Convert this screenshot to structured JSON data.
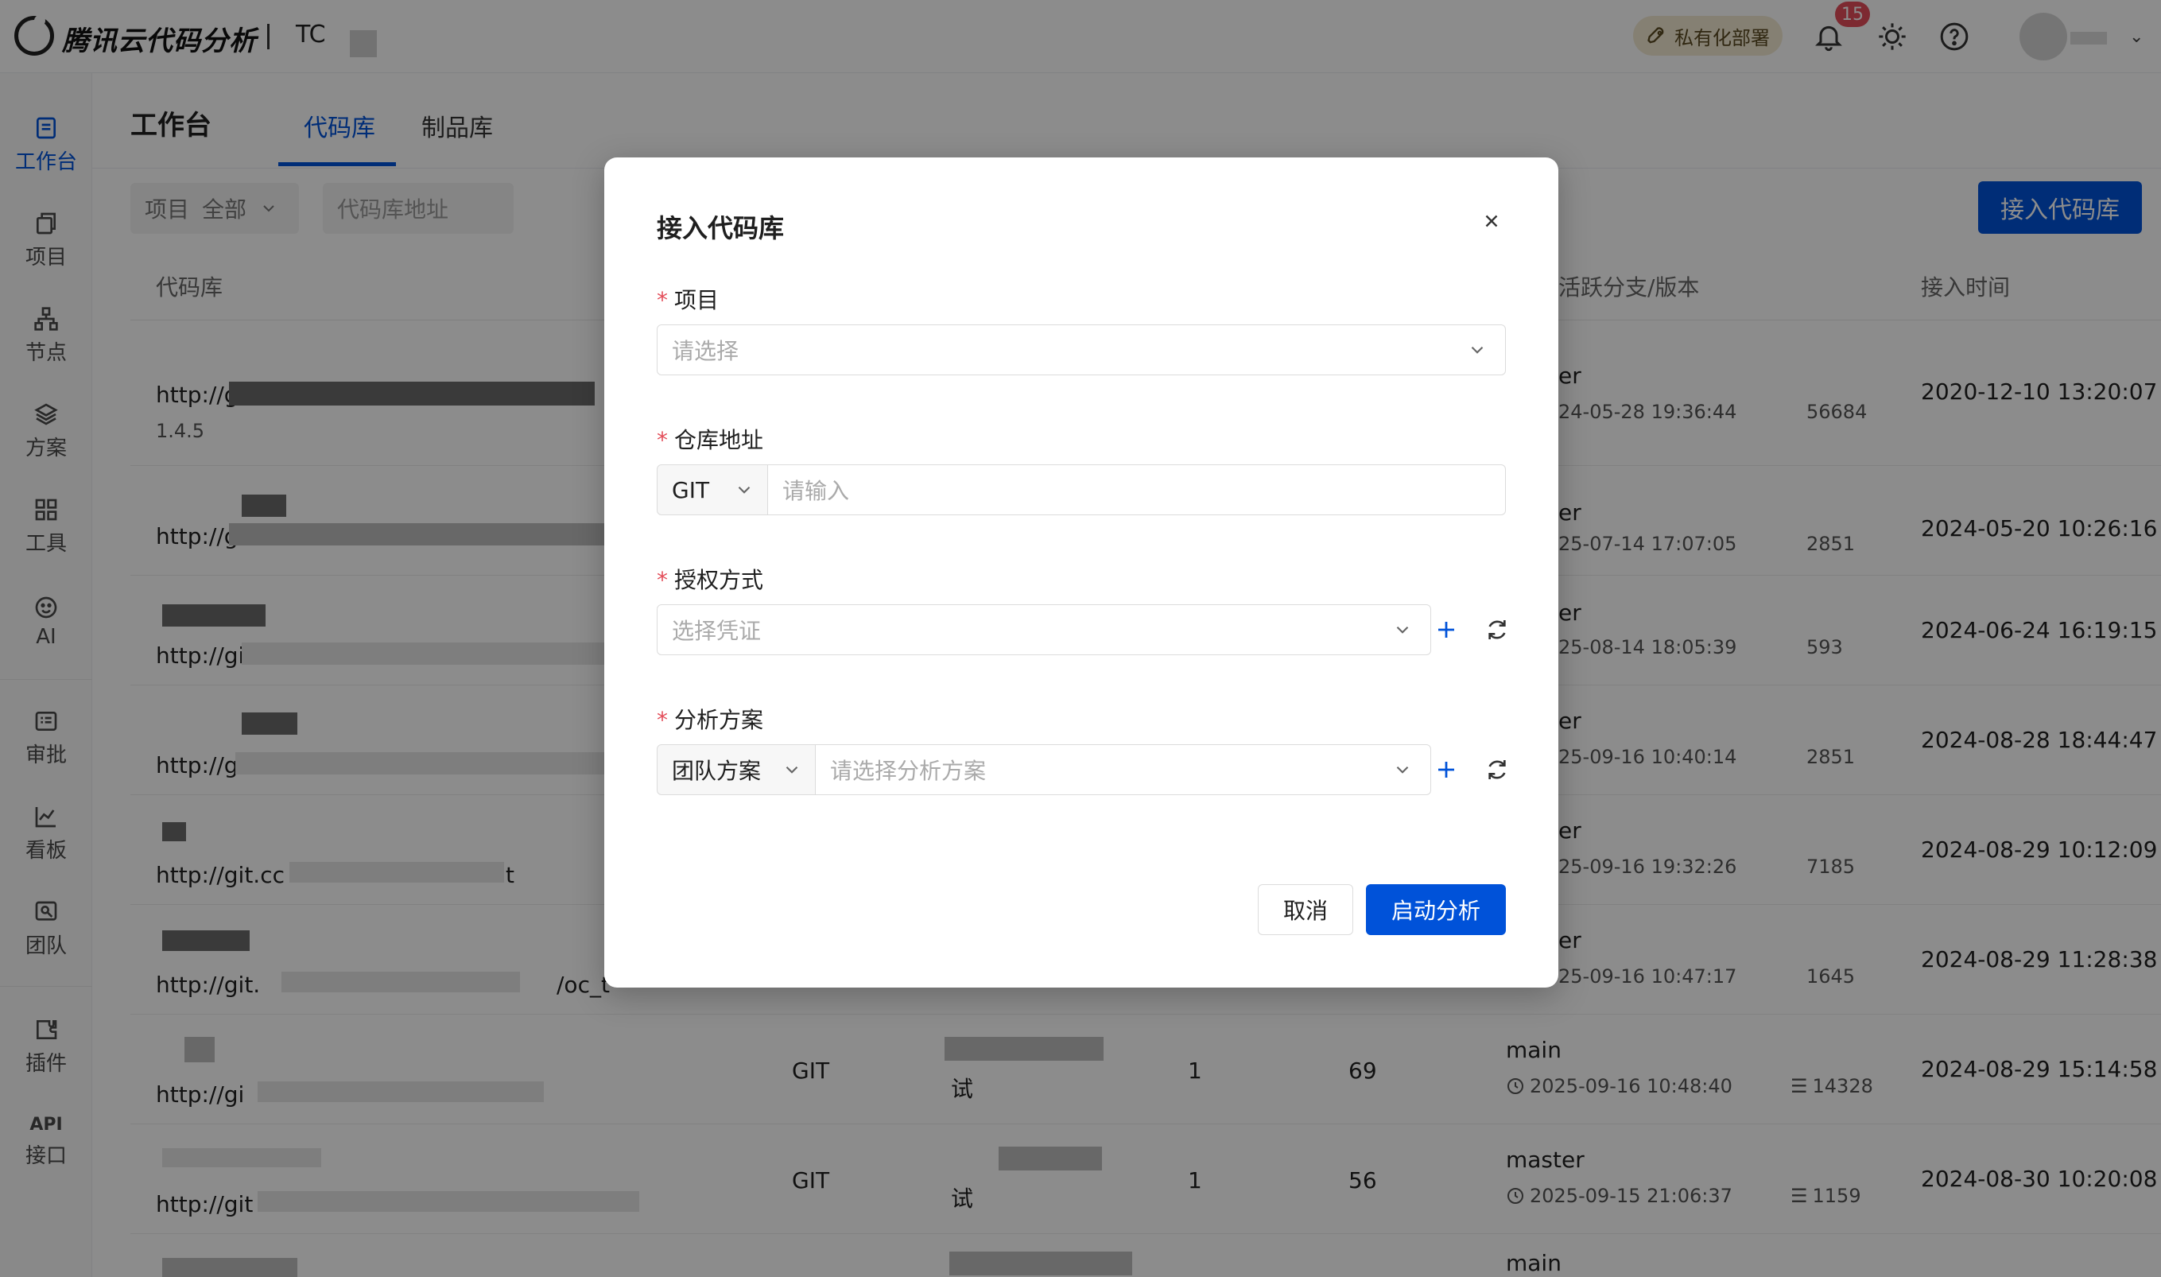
{
  "header": {
    "logo_text": "腾讯云代码分析",
    "org_text": "TC",
    "deploy_label": "私有化部署",
    "notification_count": "15"
  },
  "sidebar": {
    "items": [
      {
        "label": "工作台",
        "icon": "workbench-icon",
        "active": true
      },
      {
        "label": "项目",
        "icon": "project-icon"
      },
      {
        "label": "节点",
        "icon": "node-icon"
      },
      {
        "label": "方案",
        "icon": "layers-icon"
      },
      {
        "label": "工具",
        "icon": "tools-icon"
      },
      {
        "label": "AI",
        "icon": "ai-icon"
      },
      {
        "label": "审批",
        "icon": "approval-icon"
      },
      {
        "label": "看板",
        "icon": "dashboard-icon"
      },
      {
        "label": "团队",
        "icon": "team-icon"
      },
      {
        "label": "插件",
        "icon": "plugin-icon"
      },
      {
        "label": "接口",
        "api_label": "API",
        "icon": "api-icon"
      }
    ]
  },
  "page": {
    "title": "工作台",
    "tabs": [
      {
        "label": "代码库",
        "active": true
      },
      {
        "label": "制品库"
      }
    ]
  },
  "filters": {
    "project_label": "项目",
    "project_value": "全部",
    "repo_placeholder": "代码库地址",
    "connect_button": "接入代码库"
  },
  "table": {
    "headers": {
      "repo": "代码库",
      "branch": "活跃分支/版本",
      "time": "接入时间"
    },
    "rows": [
      {
        "url": "http://g",
        "extra": "1.4.5",
        "branch": "er",
        "updated": "24-05-28 19:36:44",
        "count": "56684",
        "joined": "2020-12-10 13:20:07"
      },
      {
        "url": "http://g",
        "branch": "er",
        "updated": "25-07-14 17:07:05",
        "count": "2851",
        "joined": "2024-05-20 10:26:16"
      },
      {
        "url": "http://git",
        "branch": "er",
        "updated": "25-08-14 18:05:39",
        "count": "593",
        "joined": "2024-06-24 16:19:15"
      },
      {
        "url": "http://gi",
        "branch": "er",
        "updated": "25-09-16 10:40:14",
        "count": "2851",
        "joined": "2024-08-28 18:44:47"
      },
      {
        "url": "http://git.cc",
        "url_tail": "t",
        "branch": "er",
        "updated": "25-09-16 19:32:26",
        "count": "7185",
        "joined": "2024-08-29 10:12:09"
      },
      {
        "url": "http://git.",
        "url_tail": "/oc_t",
        "branch": "er",
        "updated": "25-09-16 10:47:17",
        "count": "1645",
        "joined": "2024-08-29 11:28:38"
      },
      {
        "url": "http://gi",
        "scm": "GIT",
        "name_tail": "试",
        "num1": "1",
        "num2": "69",
        "branch": "main",
        "updated": "2025-09-16 10:48:40",
        "count": "14328",
        "joined": "2024-08-29 15:14:58"
      },
      {
        "url": "http://git",
        "scm": "GIT",
        "name_tail": "试",
        "num1": "1",
        "num2": "56",
        "branch": "master",
        "updated": "2025-09-15 21:06:37",
        "count": "1159",
        "joined": "2024-08-30 10:20:08"
      },
      {
        "branch": "main"
      }
    ]
  },
  "modal": {
    "title": "接入代码库",
    "project": {
      "label": "项目",
      "placeholder": "请选择"
    },
    "repo": {
      "label": "仓库地址",
      "scm": "GIT",
      "placeholder": "请输入"
    },
    "auth": {
      "label": "授权方式",
      "placeholder": "选择凭证"
    },
    "scheme": {
      "label": "分析方案",
      "type": "团队方案",
      "placeholder": "请选择分析方案"
    },
    "cancel": "取消",
    "start": "启动分析"
  },
  "colors": {
    "primary": "#0052d9",
    "required": "#e34d59",
    "badge_bg": "#f3ead2"
  }
}
